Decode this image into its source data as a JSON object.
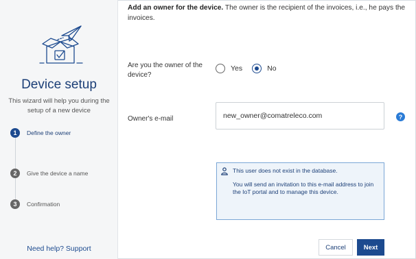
{
  "sidebar": {
    "title": "Device setup",
    "description": "This wizard will help you during the setup of a new device",
    "steps": [
      {
        "number": "1",
        "label": "Define the owner",
        "active": true
      },
      {
        "number": "2",
        "label": "Give the device a name",
        "active": false
      },
      {
        "number": "3",
        "label": "Confirmation",
        "active": false
      }
    ],
    "help_link": "Need help? Support"
  },
  "main": {
    "intro_bold": "Add an owner for the device.",
    "intro_text": " The owner is the recipient of the invoices, i.e., he pays the invoices.",
    "owner_question": "Are you the owner of the device?",
    "radio_yes": "Yes",
    "radio_no": "No",
    "selected_option": "No",
    "email_label": "Owner's e-mail",
    "email_value": "new_owner@comatreleco.com",
    "help_badge": "?",
    "info_title": "This user does not exist in the database.",
    "info_body": "You will send an invitation to this e-mail address to join the IoT portal and to manage this device.",
    "cancel_label": "Cancel",
    "next_label": "Next"
  },
  "colors": {
    "accent": "#1c4a8f",
    "info_bg": "#eef4fa",
    "info_border": "#7aa6d6",
    "help_badge": "#2a7bd6"
  },
  "icons": {
    "hero": "box-with-paper-plane-icon",
    "info": "user-icon"
  }
}
